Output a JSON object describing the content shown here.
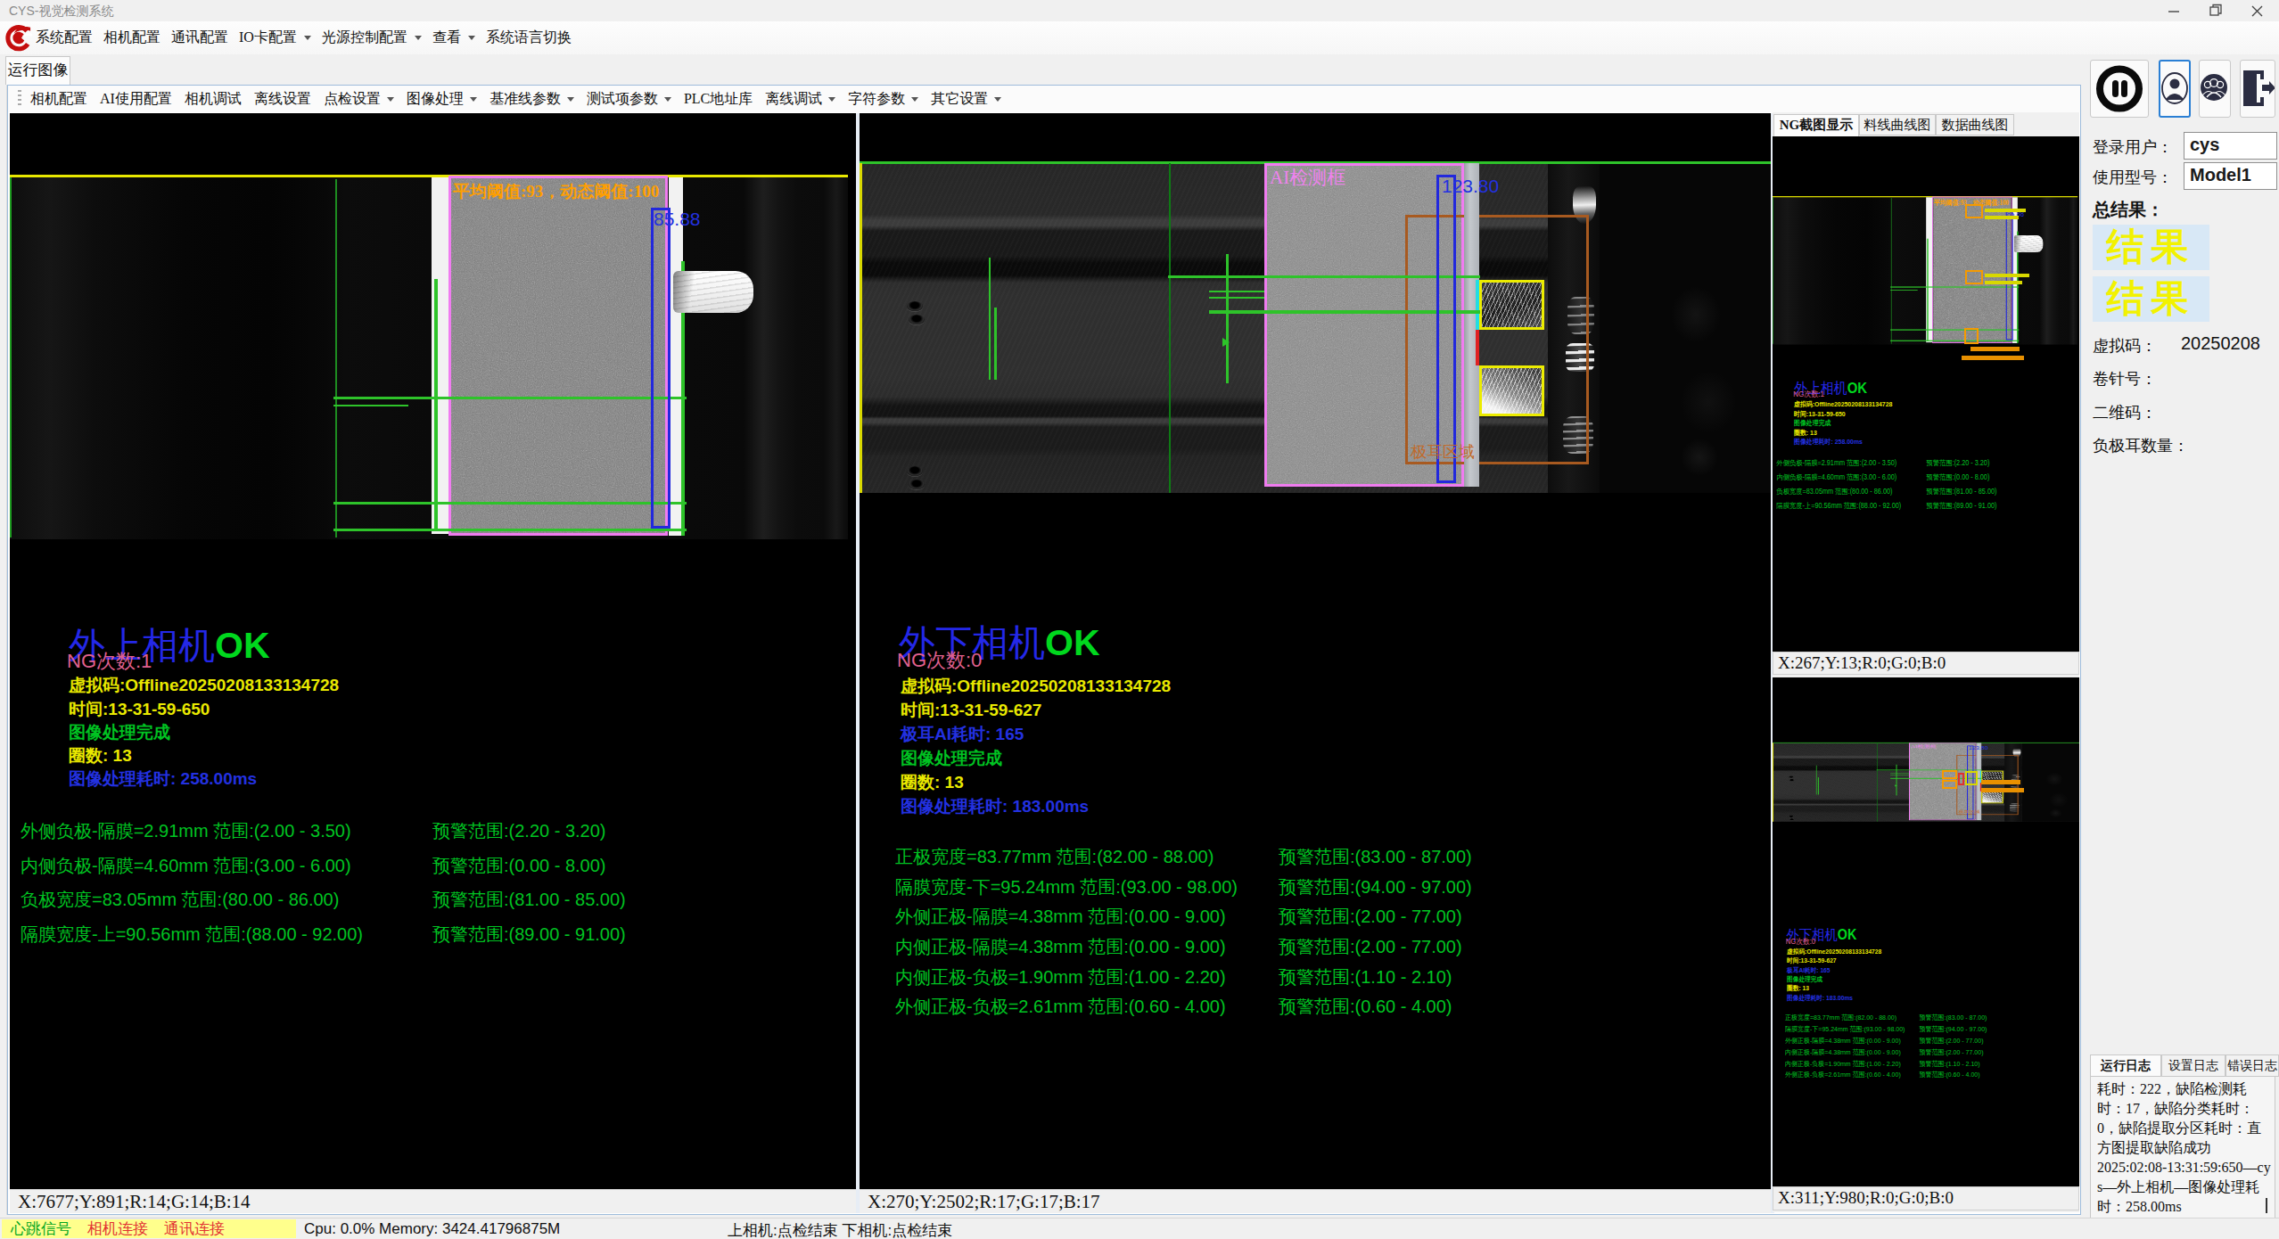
{
  "window": {
    "title": "CYS-视觉检测系统"
  },
  "menu": {
    "items": [
      {
        "label": "系统配置",
        "dropdown": false
      },
      {
        "label": "相机配置",
        "dropdown": false
      },
      {
        "label": "通讯配置",
        "dropdown": false
      },
      {
        "label": "IO卡配置",
        "dropdown": true
      },
      {
        "label": "光源控制配置",
        "dropdown": true
      },
      {
        "label": "查看",
        "dropdown": true
      },
      {
        "label": "系统语言切换",
        "dropdown": false
      }
    ]
  },
  "main_tab": {
    "label": "运行图像"
  },
  "toolbar": {
    "items": [
      {
        "label": "相机配置",
        "dropdown": false
      },
      {
        "label": "AI使用配置",
        "dropdown": false
      },
      {
        "label": "相机调试",
        "dropdown": false
      },
      {
        "label": "离线设置",
        "dropdown": false
      },
      {
        "label": "点检设置",
        "dropdown": true
      },
      {
        "label": "图像处理",
        "dropdown": true
      },
      {
        "label": "基准线参数",
        "dropdown": true
      },
      {
        "label": "测试项参数",
        "dropdown": true
      },
      {
        "label": "PLC地址库",
        "dropdown": false
      },
      {
        "label": "离线调试",
        "dropdown": true
      },
      {
        "label": "字符参数",
        "dropdown": true
      },
      {
        "label": "其它设置",
        "dropdown": true
      }
    ]
  },
  "cam1": {
    "threshold_label": "平均阈值:93，动态阈值:100",
    "width_value": "85.88",
    "title": "外上相机",
    "result": "OK",
    "ng_label": "NG次数:1",
    "info_rows": [
      {
        "text": "虚拟码:Offline20250208133134728",
        "color": "yellow"
      },
      {
        "text": "时间:13-31-59-650",
        "color": "yellow"
      },
      {
        "text": "图像处理完成",
        "color": "green"
      },
      {
        "text": "圈数: 13",
        "color": "yellow"
      },
      {
        "text": "图像处理耗时: 258.00ms",
        "color": "blue"
      }
    ],
    "measurements": [
      {
        "left": "外侧负极-隔膜=2.91mm 范围:(2.00 - 3.50)",
        "right": "预警范围:(2.20 - 3.20)"
      },
      {
        "left": "内侧负极-隔膜=4.60mm 范围:(3.00 - 6.00)",
        "right": "预警范围:(0.00 - 8.00)"
      },
      {
        "left": "负极宽度=83.05mm 范围:(80.00 - 86.00)",
        "right": "预警范围:(81.00 - 85.00)"
      },
      {
        "left": "隔膜宽度-上=90.56mm 范围:(88.00 - 92.00)",
        "right": "预警范围:(89.00 - 91.00)"
      }
    ],
    "status": "X:7677;Y:891;R:14;G:14;B:14"
  },
  "cam2": {
    "ai_box_label": "AI检测框",
    "width_value": "123.80",
    "tab_region_label": "极耳区域",
    "title": "外下相机",
    "result": "OK",
    "ng_label": "NG次数:0",
    "info_rows": [
      {
        "text": "虚拟码:Offline20250208133134728",
        "color": "yellow"
      },
      {
        "text": "时间:13-31-59-627",
        "color": "yellow"
      },
      {
        "text": "极耳AI耗时: 165",
        "color": "blue"
      },
      {
        "text": "图像处理完成",
        "color": "green"
      },
      {
        "text": "圈数: 13",
        "color": "yellow"
      },
      {
        "text": "图像处理耗时: 183.00ms",
        "color": "blue"
      }
    ],
    "measurements": [
      {
        "left": "正极宽度=83.77mm 范围:(82.00 - 88.00)",
        "right": "预警范围:(83.00 - 87.00)"
      },
      {
        "left": "隔膜宽度-下=95.24mm 范围:(93.00 - 98.00)",
        "right": "预警范围:(94.00 - 97.00)"
      },
      {
        "left": "外侧正极-隔膜=4.38mm 范围:(0.00 - 9.00)",
        "right": "预警范围:(2.00 - 77.00)"
      },
      {
        "left": "内侧正极-隔膜=4.38mm 范围:(0.00 - 9.00)",
        "right": "预警范围:(2.00 - 77.00)"
      },
      {
        "left": "内侧正极-负极=1.90mm 范围:(1.00 - 2.20)",
        "right": "预警范围:(1.10 - 2.10)"
      },
      {
        "left": "外侧正极-负极=2.61mm 范围:(0.60 - 4.00)",
        "right": "预警范围:(0.60 - 4.00)"
      }
    ],
    "status": "X:270;Y:2502;R:17;G:17;B:17"
  },
  "preview": {
    "tabs": [
      {
        "label": "NG截图显示",
        "active": true
      },
      {
        "label": "料线曲线图",
        "active": false
      },
      {
        "label": "数据曲线图",
        "active": false
      }
    ],
    "status1": "X:267;Y:13;R:0;G:0;B:0",
    "status2": "X:311;Y:980;R:0;G:0;B:0"
  },
  "sidebar": {
    "icons": [
      "pause-icon",
      "user-icon",
      "users-icon",
      "logout-icon"
    ],
    "login_user_label": "登录用户：",
    "login_user_value": "cys",
    "model_label": "使用型号：",
    "model_value": "Model1",
    "total_result_label": "总结果：",
    "result_boxes": [
      "结果",
      "结果"
    ],
    "virtual_code_label": "虚拟码：",
    "virtual_code_value": "20250208",
    "reel_label": "卷针号：",
    "qr_label": "二维码：",
    "anode_tab_count_label": "负极耳数量：",
    "log_tabs": [
      {
        "label": "运行日志",
        "active": true
      },
      {
        "label": "设置日志",
        "active": false
      },
      {
        "label": "错误日志",
        "active": false
      }
    ],
    "log_lines": [
      "耗时：222，缺陷检测耗时：17，缺陷分类耗时：0，缺陷提取分区耗时：直方图提取缺陷成功",
      "2025:02:08-13:31:59:650—cys—外上相机—图像处理耗时：258.00ms"
    ]
  },
  "statusbar": {
    "signals": [
      {
        "label": "心跳信号",
        "color": "green"
      },
      {
        "label": "相机连接",
        "color": "red"
      },
      {
        "label": "通讯连接",
        "color": "red"
      }
    ],
    "cpu": "Cpu:  0.0% Memory:  3424.41796875M",
    "cameras": "上相机:点检结束  下相机:点检结束"
  },
  "colors": {
    "overlay_yellow": "#e9e900",
    "overlay_green": "#00c322",
    "overlay_blue": "#2331e0",
    "overlay_orange": "#ff9f00",
    "overlay_pink": "#ee82ee",
    "overlay_brown": "#c06a2a",
    "ng_pink": "#e0608e",
    "title_blue": "#2428e8",
    "ok_green": "#00d81e",
    "result_text_yellow": "#f2f200",
    "result_box_blue": "#d8e8f6",
    "signal_bg_yellow": "#ffff8c",
    "selected_button_border": "#2a7fd4"
  }
}
